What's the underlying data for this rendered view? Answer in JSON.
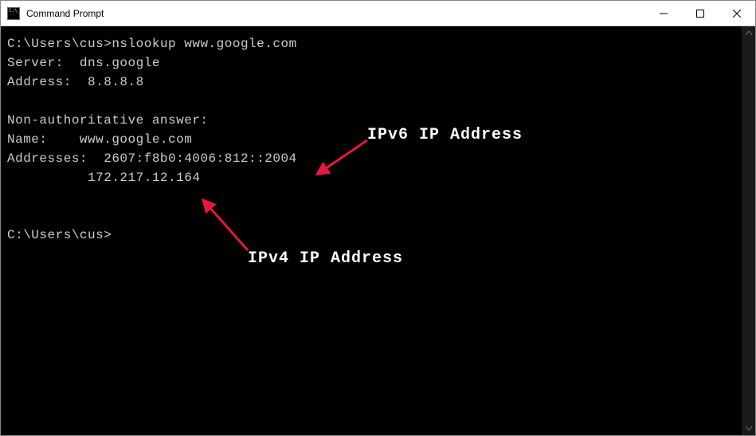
{
  "titlebar": {
    "title": "Command Prompt"
  },
  "terminal": {
    "line1_prompt": "C:\\Users\\cus>",
    "line1_cmd": "nslookup www.google.com",
    "line2": "Server:  dns.google",
    "line3": "Address:  8.8.8.8",
    "blank1": "",
    "line4": "Non-authoritative answer:",
    "line5": "Name:    www.google.com",
    "line6": "Addresses:  2607:f8b0:4006:812::2004",
    "line7": "          172.217.12.164",
    "blank2": "",
    "blank3": "",
    "line8": "C:\\Users\\cus>"
  },
  "annotations": {
    "ipv6": "IPv6 IP Address",
    "ipv4": "IPv4 IP Address"
  },
  "colors": {
    "arrow": "#e8173d"
  }
}
